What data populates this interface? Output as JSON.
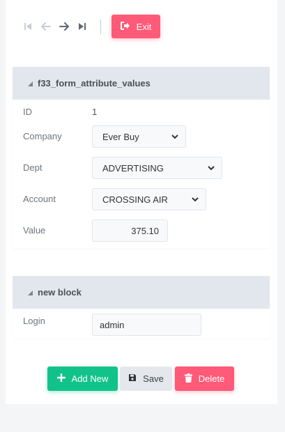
{
  "toolbar": {
    "first_icon": "first-record-icon",
    "prev_icon": "previous-record-icon",
    "next_icon": "next-record-icon",
    "last_icon": "last-record-icon",
    "exit_label": "Exit",
    "exit_icon": "sign-out-icon"
  },
  "form_panel": {
    "title": "f33_form_attribute_values",
    "fields": {
      "id": {
        "label": "ID",
        "value": "1"
      },
      "company": {
        "label": "Company",
        "value": "Ever Buy"
      },
      "dept": {
        "label": "Dept",
        "value": "ADVERTISING"
      },
      "account": {
        "label": "Account",
        "value": "CROSSING AIR"
      },
      "value": {
        "label": "Value",
        "value": "375.10"
      }
    }
  },
  "new_block_panel": {
    "title": "new block",
    "fields": {
      "login": {
        "label": "Login",
        "value": "admin"
      }
    }
  },
  "actions": {
    "add_new_label": "Add New",
    "save_label": "Save",
    "delete_label": "Delete"
  },
  "colors": {
    "accent_red": "#ff5a78",
    "accent_green": "#12c389",
    "panel_header": "#e2e7ed",
    "neutral_button": "#e4e8ed"
  }
}
